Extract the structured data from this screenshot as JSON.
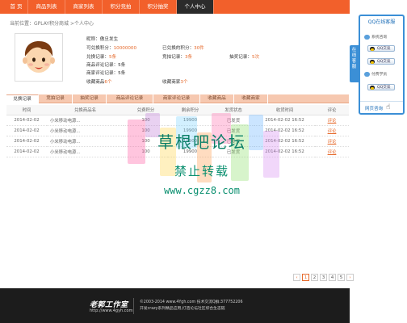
{
  "nav": {
    "items": [
      {
        "label": "首  页"
      },
      {
        "label": "商品列表"
      },
      {
        "label": "商家列表"
      },
      {
        "label": "积分竞拍"
      },
      {
        "label": "积分抽奖"
      },
      {
        "label": "个人中心"
      }
    ],
    "active_index": 5
  },
  "breadcrumb": "当前位置：GPLAY积分商城 >个人中心",
  "profile": {
    "nickname_label": "昵称：",
    "nickname": "傲旦发生",
    "available_points_label": "可兑换积分：",
    "available_points": "10000000",
    "redeemed_points_label": "已兑换的积分：",
    "redeemed_points": "30件",
    "exchange_records_label": "兑换记录：",
    "exchange_records": "5条",
    "bid_records_label": "竞拍记录：",
    "bid_records": "3条",
    "lottery_records_label": "抽奖记录：",
    "lottery_records": "5次",
    "product_comments_label": "商品评论记录：",
    "product_comments": "5条",
    "merchant_comments_label": "商家评论记录：",
    "merchant_comments": "5条",
    "fav_products_label": "收藏商品",
    "fav_products": "6个",
    "fav_merchants_label": "收藏商家",
    "fav_merchants": "3个"
  },
  "tabs": [
    {
      "label": "兑换记录"
    },
    {
      "label": "竞拍记录"
    },
    {
      "label": "抽奖记录"
    },
    {
      "label": "商品评论记录"
    },
    {
      "label": "商家评论记录"
    },
    {
      "label": "收藏商品"
    },
    {
      "label": "收藏商家"
    }
  ],
  "table": {
    "headers": [
      "时间",
      "兑换商品名",
      "兑费积分",
      "剩余积分",
      "发货状态",
      "收货时间",
      "评论"
    ],
    "rows": [
      [
        "2014-02-02",
        "小米移动电源...",
        "100",
        "19900",
        "已发货",
        "2014-02-02  16:52",
        "评论"
      ],
      [
        "2014-02-02",
        "小米移动电源...",
        "100",
        "19900",
        "已发货",
        "2014-02-02  16:52",
        "评论"
      ],
      [
        "2014-02-02",
        "小米移动电源...",
        "100",
        "19900",
        "已发货",
        "2014-02-02  16:52",
        "评论"
      ],
      [
        "2014-02-02",
        "小米移动电源...",
        "100",
        "19900",
        "已发货",
        "2014-02-02  16:52",
        "评论"
      ]
    ]
  },
  "watermark": {
    "line1": "草根吧论坛",
    "line2": "禁止转载",
    "line3": "www.cgzz8.com"
  },
  "pager": {
    "prev": "‹",
    "pages": [
      "1",
      "2",
      "3",
      "4",
      "5"
    ],
    "current": "1",
    "next": "›"
  },
  "footer": {
    "logo": "老郭工作室",
    "url": "http://www.4gyh.com",
    "line1": "©2003-2014  www.4Ygh.com  技术交流Q群:377752206",
    "line2": "开发crazy系列精品应用,打造论坛社区综合生态链"
  },
  "side_tab": "在线客服",
  "side": {
    "title": "QQ在线客服",
    "rows": [
      {
        "label": "系统咨询",
        "icon": "chat-icon"
      },
      {
        "label": "QQ交谈",
        "icon": "qq-icon"
      },
      {
        "label": "QQ交谈",
        "icon": "qq-icon"
      },
      {
        "label": "付费学员",
        "icon": "chat-icon"
      },
      {
        "label": "QQ交谈",
        "icon": "qq-icon"
      }
    ],
    "link": "网页咨询"
  },
  "colors": {
    "nav_bg": "#f2602b",
    "accent": "#e66a2c",
    "side_blue": "#3b8fd6",
    "footer_bg": "#1c1c1c"
  }
}
